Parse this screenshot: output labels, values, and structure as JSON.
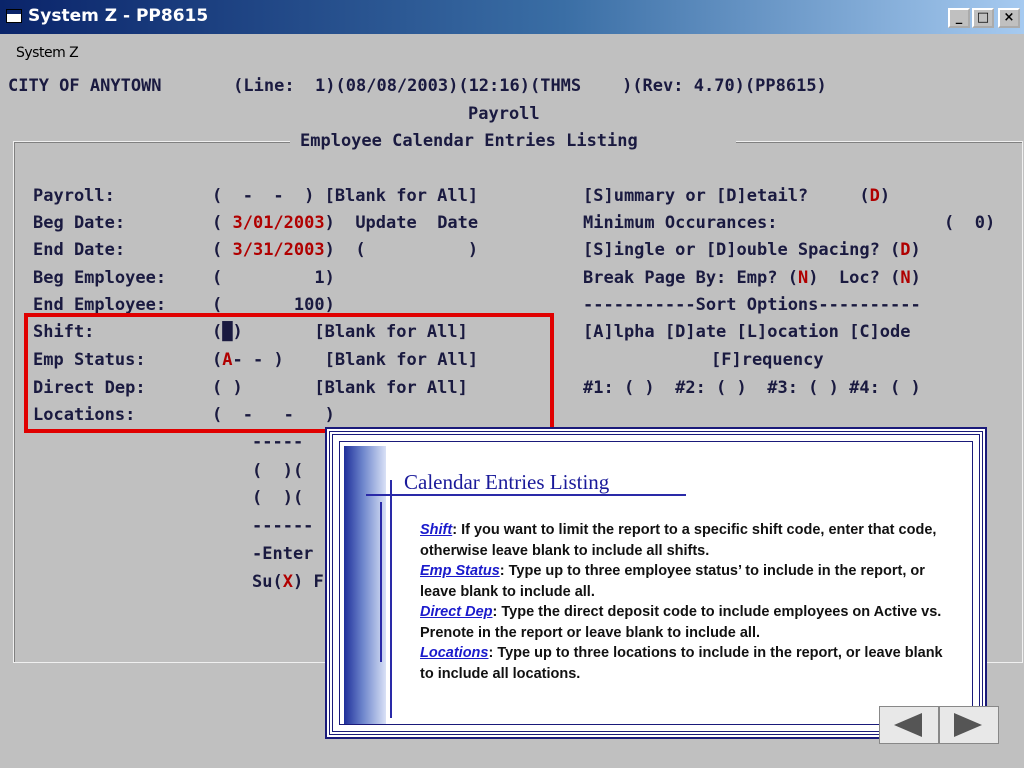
{
  "window": {
    "title": "System Z - PP8615",
    "icon": "window-app-icon",
    "minimize": "_",
    "maximize": "□",
    "close": "×"
  },
  "menu": {
    "system": "System Z"
  },
  "header": {
    "line1": "CITY OF ANYTOWN       (Line:  1)(08/08/2003)(12:16)(THMS    )(Rev: 4.70)(PP8615)",
    "line2": "Payroll",
    "line3": "Employee Calendar Entries Listing"
  },
  "form": {
    "payroll": {
      "label": "Payroll:",
      "value": "(  -  -  ) [Blank for All]"
    },
    "beg_date": {
      "label": "Beg Date:",
      "open": "( ",
      "value": "3/01/2003",
      "close": ")  Update  Date"
    },
    "end_date": {
      "label": "End Date:",
      "open": "( ",
      "value": "3/31/2003",
      "close": ")  (          )"
    },
    "beg_employee": {
      "label": "Beg Employee:",
      "value": "(         1)"
    },
    "end_employee": {
      "label": "End Employee:",
      "value": "(       100)"
    },
    "shift": {
      "label": "Shift:",
      "value": "(█)       [Blank for All]"
    },
    "emp_status": {
      "label": "Emp Status:",
      "open": "(",
      "value": "A",
      "close": "- - )    [Blank for All]"
    },
    "direct_dep": {
      "label": "Direct Dep:",
      "value": "( )       [Blank for All]"
    },
    "locations": {
      "label": "Locations:",
      "value": "(  -   -   )"
    }
  },
  "right_panel": {
    "summary_label": "[S]ummary or [D]etail?",
    "summary_open": "     (",
    "summary_value": "D",
    "summary_close": ")",
    "min_occ_label": "Minimum Occurances:",
    "min_occ_value": "(  0)",
    "spacing_label": "[S]ingle or [D]ouble Spacing? (",
    "spacing_value": "D",
    "spacing_close": ")",
    "break_label": "Break Page By: Emp? (",
    "break_emp": "N",
    "break_mid": ")  Loc? (",
    "break_loc": "N",
    "break_close": ")",
    "sort_header": "-----------Sort Options----------",
    "sort_opts_1": "[A]lpha [D]ate [L]ocation [C]ode",
    "sort_opts_2": "[F]requency",
    "sort_slots": "#1: ( )  #2: ( )  #3: ( ) #4: ( )"
  },
  "lower": {
    "dashes1": "-----",
    "row1": "(  )(",
    "row2": "(  )(",
    "dashes2": "------",
    "enter": "-Enter",
    "su_prefix": "Su(",
    "su_value": "X",
    "su_suffix": ") F"
  },
  "help": {
    "title": "Calendar Entries Listing",
    "shift_term": "Shift",
    "shift_text": ":  If you want to limit the report to a specific shift code, enter that code, otherwise leave blank to include all shifts.",
    "status_term": "Emp Status",
    "status_text": ":  Type up to three employee status’ to include in the report, or leave blank to include all.",
    "dep_term": "Direct Dep",
    "dep_text": ":  Type the direct deposit code to include employees on Active vs. Prenote in the report or leave blank to include all.",
    "loc_term": "Locations",
    "loc_text": ":  Type up to three locations to include in the report, or leave blank to include all locations."
  },
  "nav": {
    "prev_icon": "left-arrow-icon",
    "next_icon": "right-arrow-icon"
  },
  "colors": {
    "highlight": "#e00000",
    "field_value": "#b00000",
    "accent": "#1a1a9a"
  }
}
